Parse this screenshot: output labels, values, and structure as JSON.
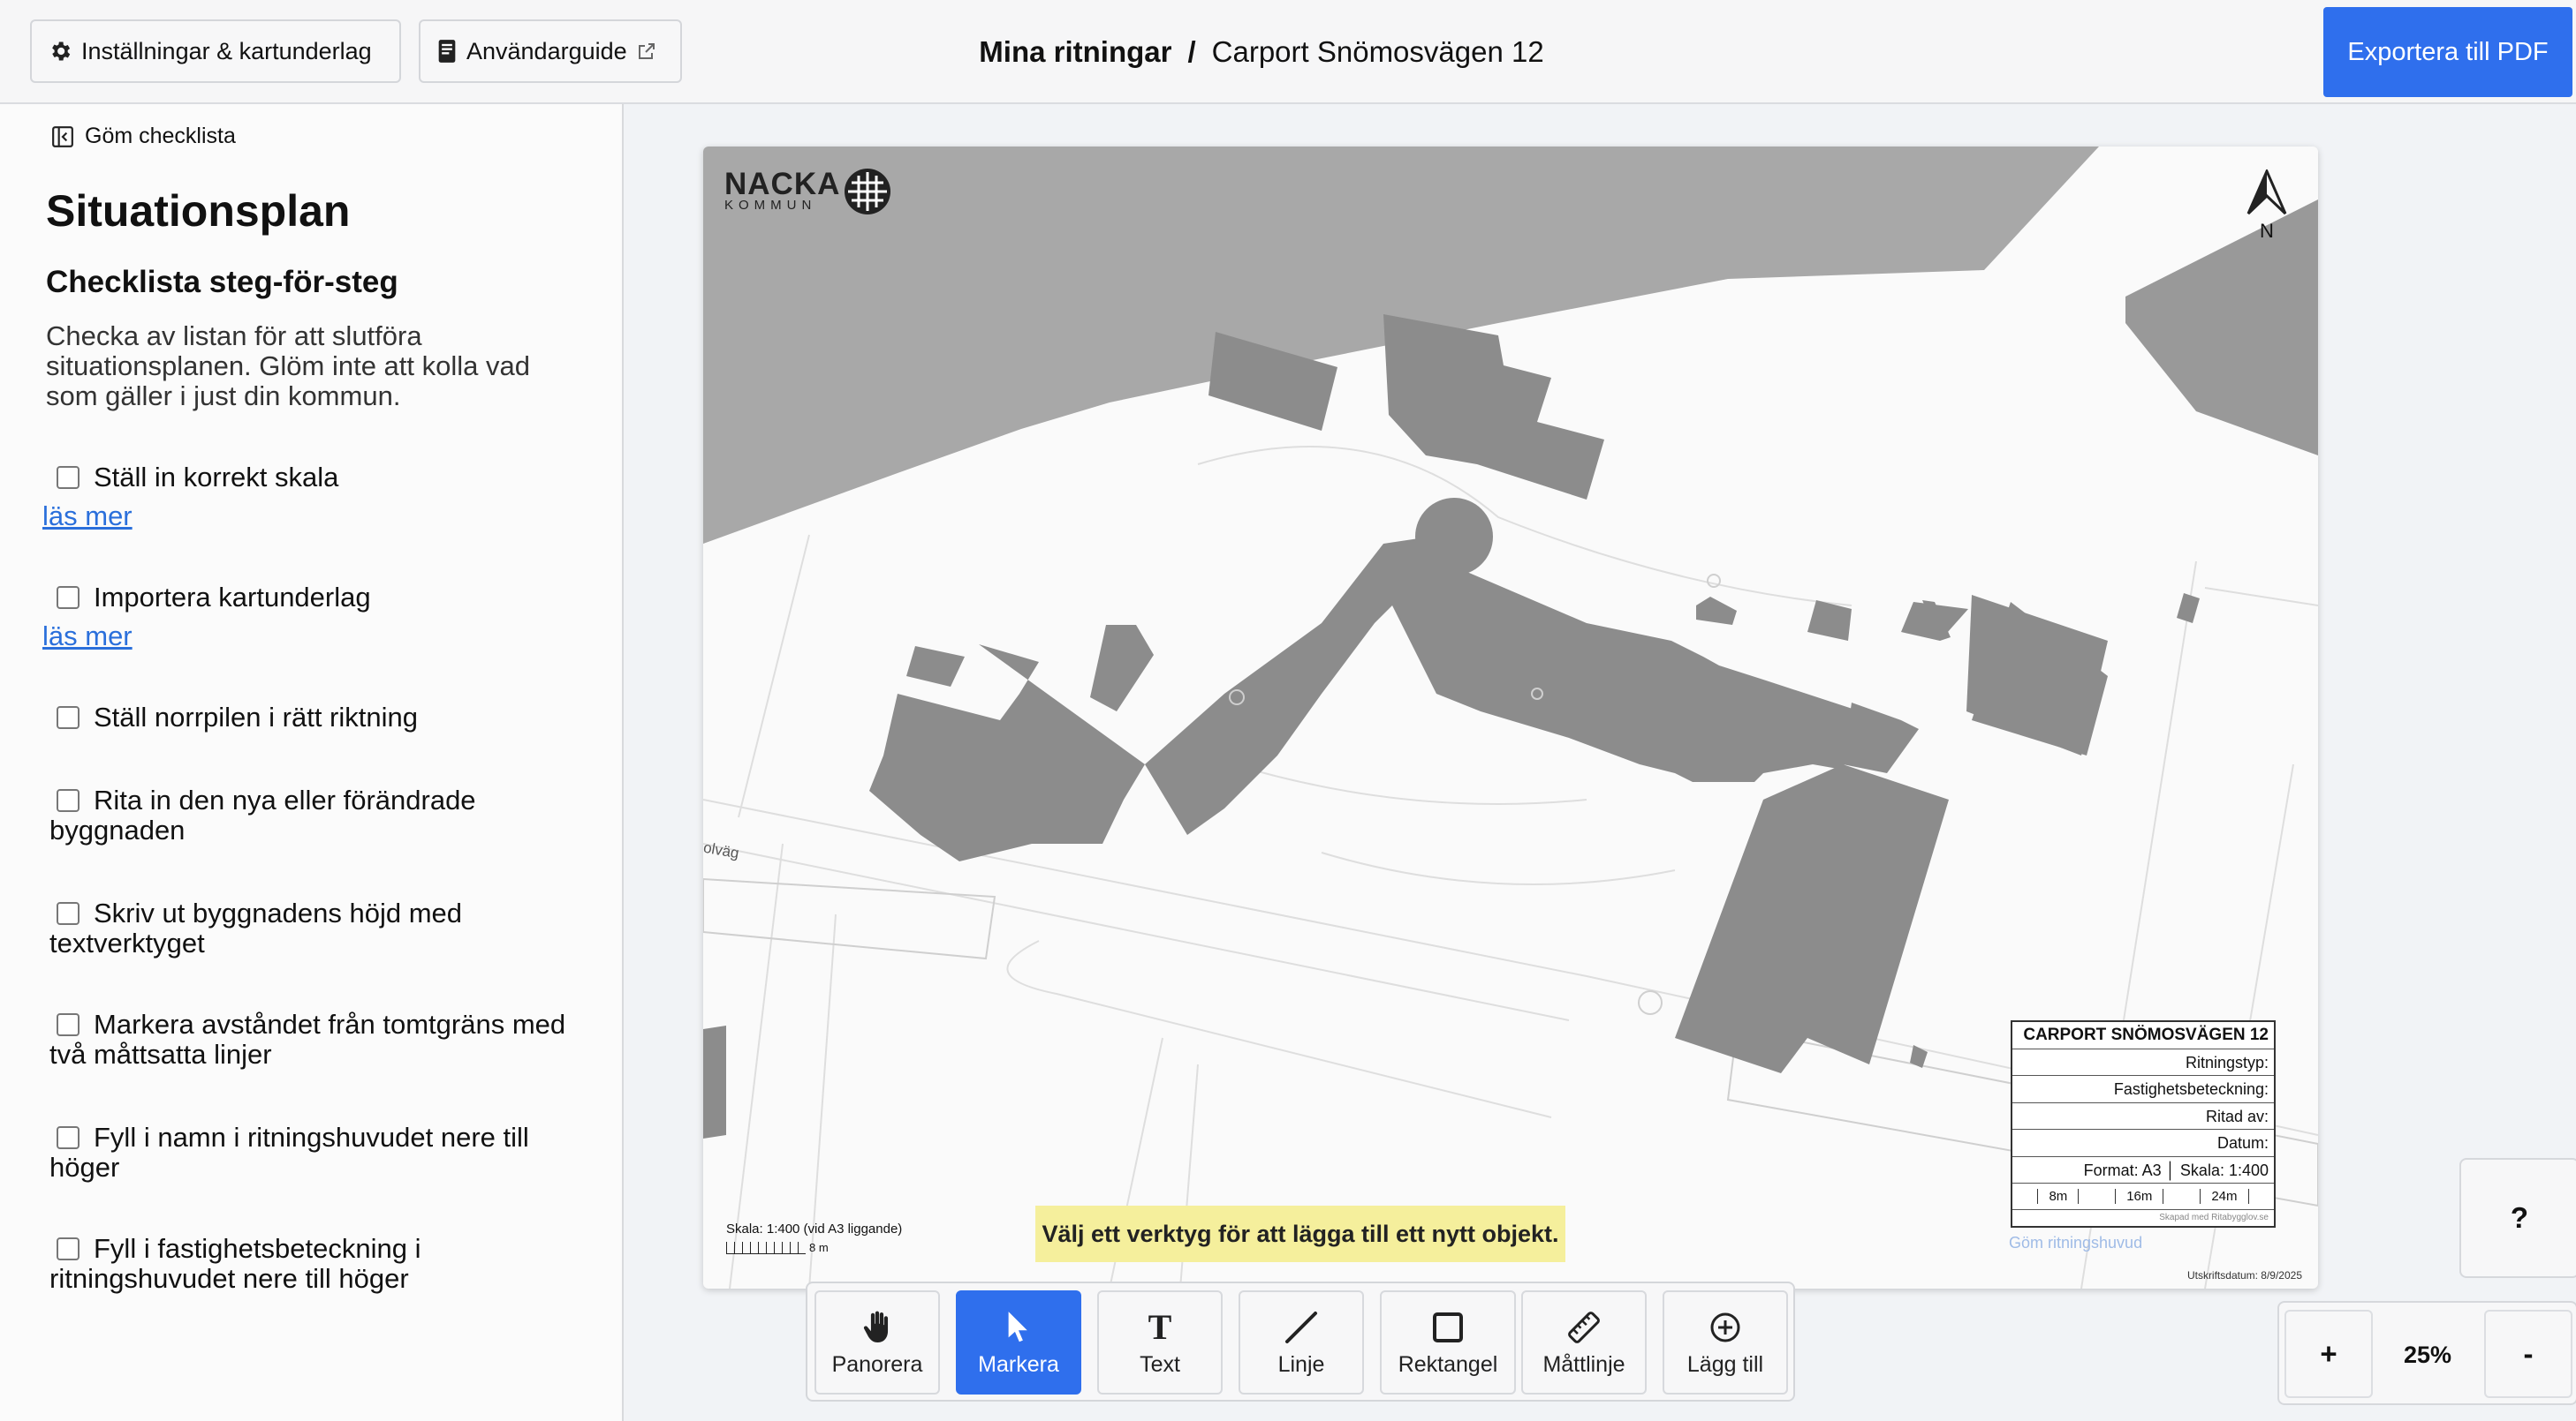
{
  "header": {
    "settings_label": "Inställningar & kartunderlag",
    "guide_label": "Användarguide",
    "breadcrumb_root": "Mina ritningar",
    "breadcrumb_sep": "/",
    "breadcrumb_current": "Carport Snömosvägen 12",
    "export_label": "Exportera till PDF"
  },
  "sidebar": {
    "hide_label": "Göm checklista",
    "title": "Situationsplan",
    "subtitle": "Checklista steg-för-steg",
    "description": "Checka av listan för att slutföra situationsplanen. Glöm inte att kolla vad som gäller i just din kommun.",
    "read_more": "läs mer",
    "tasks": [
      {
        "label": "Ställ in korrekt skala",
        "checked": false
      },
      {
        "label": "Importera kartunderlag",
        "checked": false
      },
      {
        "label": "Ställ norrpilen i rätt riktning",
        "checked": false
      },
      {
        "label": "Rita in den nya eller förändrade byggnaden",
        "checked": false
      },
      {
        "label": "Skriv ut byggnadens höjd med textverktyget",
        "checked": false
      },
      {
        "label": "Markera avståndet från tomtgräns med två måttsatta linjer",
        "checked": false
      },
      {
        "label": "Fyll i namn i ritningshuvudet nere till höger",
        "checked": false
      },
      {
        "label": "Fyll i fastighetsbeteckning i ritningshuvudet nere till höger",
        "checked": false
      }
    ]
  },
  "drawing": {
    "logo_name": "NACKA",
    "logo_sub": "KOMMUN",
    "north_label": "N",
    "street_label": "olväg",
    "scale_text": "Skala: 1:400 (vid A3 liggande)",
    "scale_bar_label": "8 m",
    "print_date": "Utskriftsdatum: 8/9/2025",
    "hide_header": "Göm ritningshuvud",
    "title_block": {
      "title": "CARPORT SNÖMOSVÄGEN 12",
      "type": "Ritningstyp:",
      "property": "Fastighetsbeteckning:",
      "drawn_by": "Ritad av:",
      "date": "Datum:",
      "format": "Format: A3 │ Skala: 1:400",
      "scale_marks": [
        "8m",
        "16m",
        "24m"
      ],
      "made_with": "Skapad med Ritabygglov.se"
    }
  },
  "hint": "Välj ett verktyg för att lägga till ett nytt objekt.",
  "toolbar": {
    "tools": [
      {
        "label": "Panorera",
        "icon": "hand-icon",
        "active": false
      },
      {
        "label": "Markera",
        "icon": "cursor-icon",
        "active": true
      },
      {
        "label": "Text",
        "icon": "text-icon",
        "active": false
      },
      {
        "label": "Linje",
        "icon": "line-icon",
        "active": false
      },
      {
        "label": "Rektangel",
        "icon": "rectangle-icon",
        "active": false
      },
      {
        "label": "Måttlinje",
        "icon": "ruler-icon",
        "active": false
      },
      {
        "label": "Lägg till",
        "icon": "plus-circle-icon",
        "active": false
      }
    ]
  },
  "help_label": "?",
  "zoom": {
    "in": "+",
    "out": "-",
    "value": "25%"
  },
  "colors": {
    "accent": "#2f6fed",
    "hint_bg": "#f5ef9c",
    "building": "#8c8c8c",
    "land_dark": "#a8a8a8"
  }
}
